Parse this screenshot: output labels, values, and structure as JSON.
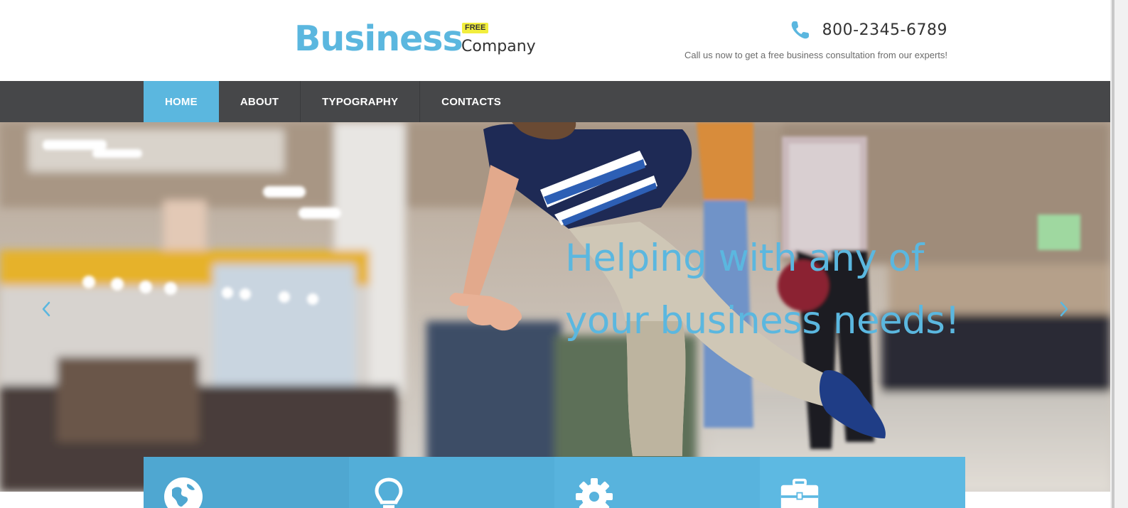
{
  "logo": {
    "main": "Business",
    "badge": "FREE",
    "sub": "Company"
  },
  "contact": {
    "icon": "phone-icon",
    "phone": "800-2345-6789",
    "tagline": "Call us now to get a free business consultation from our experts!"
  },
  "nav": {
    "items": [
      {
        "label": "HOME",
        "active": true
      },
      {
        "label": "ABOUT",
        "active": false
      },
      {
        "label": "TYPOGRAPHY",
        "active": false
      },
      {
        "label": "CONTACTS",
        "active": false
      }
    ]
  },
  "hero": {
    "headline_line1": "Helping with any of",
    "headline_line2": "your business needs!",
    "prev_icon": "chevron-left-icon",
    "next_icon": "chevron-right-icon"
  },
  "features": [
    {
      "icon": "globe-icon",
      "color": "#4fa7d1"
    },
    {
      "icon": "lightbulb-icon",
      "color": "#53aed8"
    },
    {
      "icon": "gear-icon",
      "color": "#58b3dd"
    },
    {
      "icon": "briefcase-icon",
      "color": "#5db9e2"
    }
  ],
  "colors": {
    "accent": "#5bb7df",
    "nav_bg": "#464749",
    "badge": "#f2ee3d"
  }
}
